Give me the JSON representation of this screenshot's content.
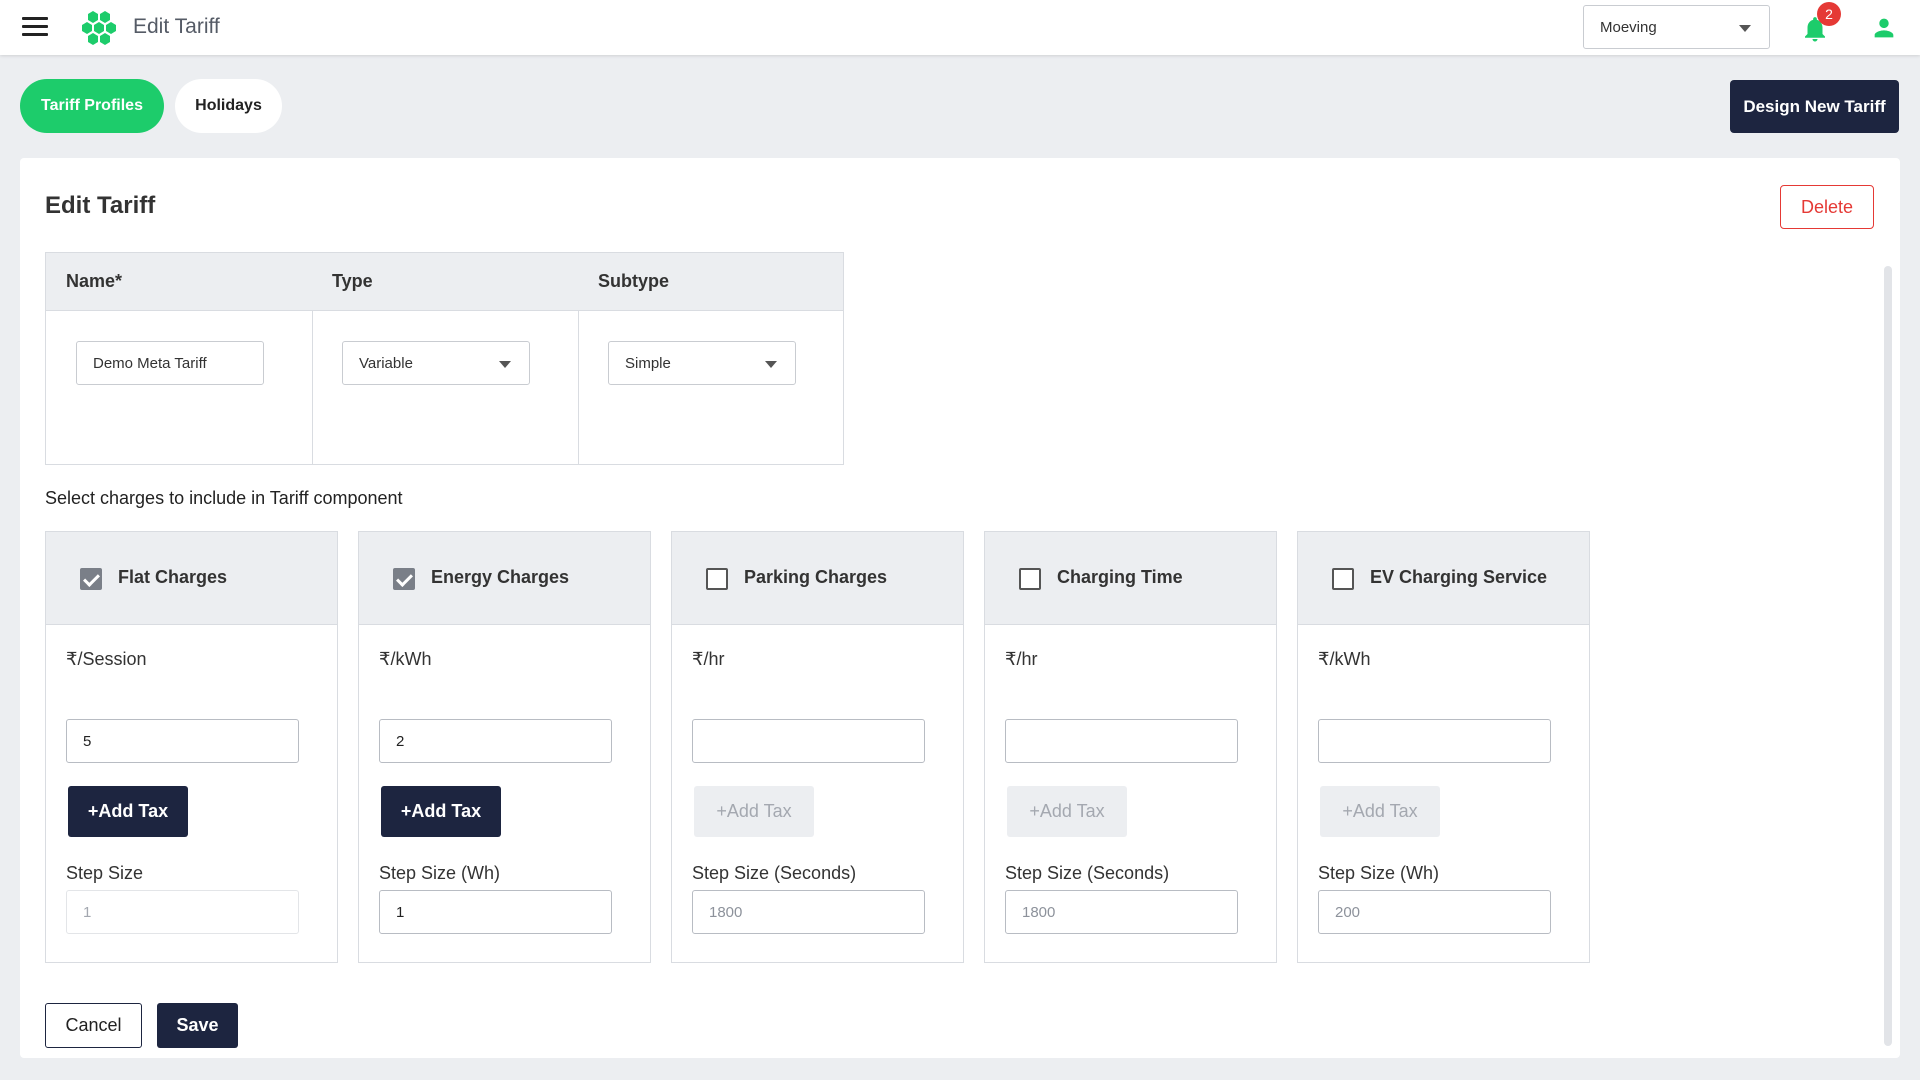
{
  "header": {
    "title": "Edit Tariff",
    "org_select": "Moeving",
    "notification_count": "2",
    "icons": {
      "menu": "hamburger-menu-icon",
      "logo": "hexagon-cluster-logo",
      "bell": "bell-icon",
      "user": "user-icon"
    }
  },
  "tabs": [
    {
      "label": "Tariff Profiles",
      "active": true
    },
    {
      "label": "Holidays",
      "active": false
    }
  ],
  "design_button": "Design New Tariff",
  "panel": {
    "title": "Edit Tariff",
    "delete_label": "Delete",
    "table": {
      "headers": {
        "name": "Name*",
        "type": "Type",
        "subtype": "Subtype"
      },
      "name_value": "Demo Meta Tariff",
      "type_value": "Variable",
      "subtype_value": "Simple"
    },
    "charges_label": "Select charges to include in Tariff component",
    "cards": [
      {
        "title": "Flat Charges",
        "checked": true,
        "unit": "₹/Session",
        "value": "5",
        "add_tax": "+Add Tax",
        "step_label": "Step Size",
        "step_value": "1"
      },
      {
        "title": "Energy Charges",
        "checked": true,
        "unit": "₹/kWh",
        "value": "2",
        "add_tax": "+Add Tax",
        "step_label": "Step Size (Wh)",
        "step_value": "1"
      },
      {
        "title": "Parking Charges",
        "checked": false,
        "unit": "₹/hr",
        "value": "",
        "add_tax": "+Add Tax",
        "step_label": "Step Size (Seconds)",
        "step_value": "1800"
      },
      {
        "title": "Charging Time",
        "checked": false,
        "unit": "₹/hr",
        "value": "",
        "add_tax": "+Add Tax",
        "step_label": "Step Size (Seconds)",
        "step_value": "1800"
      },
      {
        "title": "EV Charging Service",
        "checked": false,
        "unit": "₹/kWh",
        "value": "",
        "add_tax": "+Add Tax",
        "step_label": "Step Size (Wh)",
        "step_value": "200"
      }
    ],
    "cancel_label": "Cancel",
    "save_label": "Save"
  },
  "colors": {
    "brand_green": "#1dcc6b",
    "navy": "#1d2540",
    "danger": "#e53935"
  }
}
